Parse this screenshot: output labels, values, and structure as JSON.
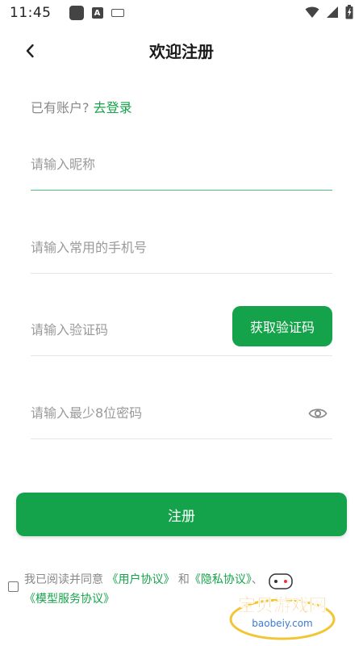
{
  "status_bar": {
    "time": "11:45"
  },
  "header": {
    "title": "欢迎注册"
  },
  "login": {
    "prompt": "已有账户?",
    "link": "去登录"
  },
  "form": {
    "nickname_placeholder": "请输入昵称",
    "phone_placeholder": "请输入常用的手机号",
    "code_placeholder": "请输入验证码",
    "get_code_label": "获取验证码",
    "password_placeholder": "请输入最少8位密码"
  },
  "register_label": "注册",
  "agreement": {
    "prefix": "我已阅读并同意",
    "user_agreement": "《用户协议》",
    "and": "和",
    "privacy_agreement": "《隐私协议》",
    "model_agreement": "《模型服务协议》"
  },
  "watermark": {
    "text": "宝贝游戏网",
    "url": "baobeiy.com"
  },
  "colors": {
    "accent": "#14a34a",
    "link": "#16a34a"
  }
}
